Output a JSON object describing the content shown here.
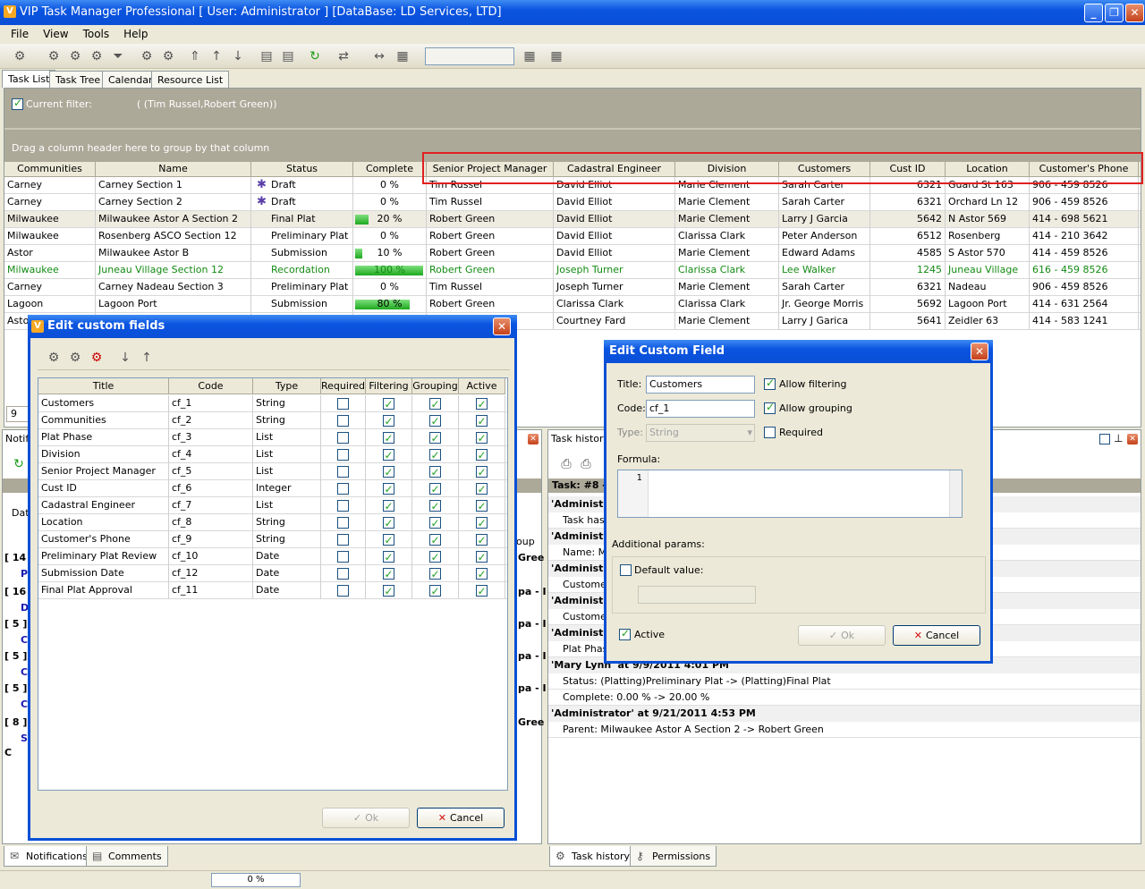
{
  "window": {
    "title": "VIP Task Manager Professional [ User: Administrator ] [DataBase: LD Services, LTD]"
  },
  "menu": [
    "File",
    "View",
    "Tools",
    "Help"
  ],
  "tabs": [
    "Task List",
    "Task Tree",
    "Calendar",
    "Resource List"
  ],
  "filter": {
    "label": "Current filter:",
    "value": "( (Tim Russel,Robert Green))"
  },
  "groupbar": {
    "hint": "Drag a column header here to group by that column"
  },
  "grid": {
    "columns": [
      "Communities",
      "Name",
      "Status",
      "Complete",
      "Senior Project Manager",
      "Cadastral Engineer",
      "Division",
      "Customers",
      "Cust ID",
      "Location",
      "Customer's Phone"
    ],
    "rows": [
      [
        "Carney",
        "Carney Section 1",
        "Draft",
        "0 %",
        "Tim Russel",
        "David Elliot",
        "Marie Clement",
        "Sarah Carter",
        "6321",
        "Guard St 163",
        "906 - 459 8526"
      ],
      [
        "Carney",
        "Carney Section 2",
        "Draft",
        "0 %",
        "Tim Russel",
        "David Elliot",
        "Marie Clement",
        "Sarah Carter",
        "6321",
        "Orchard Ln 12",
        "906 - 459 8526"
      ],
      [
        "Milwaukee",
        "Milwaukee  Astor A Section 2",
        "Final Plat",
        "20 %",
        "Robert Green",
        "David Elliot",
        "Marie Clement",
        "Larry J Garcia",
        "5642",
        "N Astor 569",
        "414 - 698 5621"
      ],
      [
        "Milwaukee",
        "Rosenberg ASCO Section 12",
        "Preliminary Plat",
        "0 %",
        "Robert Green",
        "David Elliot",
        "Clarissa Clark",
        "Peter Anderson",
        "6512",
        "Rosenberg",
        "414 - 210 3642"
      ],
      [
        "Astor",
        "Milwaukee Astor B",
        "Submission",
        "10 %",
        "Robert Green",
        "David Elliot",
        "Marie Clement",
        "Edward Adams",
        "4585",
        "S Astor 570",
        "414 - 459 8526"
      ],
      [
        "Milwaukee",
        "Juneau Village Section 12",
        "Recordation",
        "100 %",
        "Robert Green",
        "Joseph Turner",
        "Clarissa Clark",
        "Lee Walker",
        "1245",
        "Juneau Village",
        "616 - 459 8526"
      ],
      [
        "Carney",
        "Carney Nadeau Section 3",
        "Preliminary Plat",
        "0 %",
        "Tim Russel",
        "Joseph Turner",
        "Marie Clement",
        "Sarah Carter",
        "6321",
        "Nadeau",
        "906 - 459 8526"
      ],
      [
        "Lagoon",
        "Lagoon Port",
        "Submission",
        "80 %",
        "Robert Green",
        "Clarissa Clark",
        "Clarissa Clark",
        "Jr. George Morris",
        "5692",
        "Lagoon Port",
        "414 - 631 2564"
      ],
      [
        "Astor",
        "",
        "",
        "",
        "",
        "Courtney Fard",
        "Marie Clement",
        "Larry J Garica",
        "5641",
        "Zeidler 63",
        "414 - 583 1241"
      ]
    ],
    "progress": [
      0,
      0,
      20,
      0,
      10,
      100,
      0,
      80,
      0
    ],
    "footer_count": "9"
  },
  "panels": {
    "left_title": "Notifi",
    "left_label": "Dat",
    "left_group_col": "oup",
    "left_lines": [
      "[ 14",
      "P",
      "[ 16",
      "D",
      "[ 5 ]",
      "C",
      "[ 5 ]",
      "C",
      "[ 5 ]",
      "C",
      "[ 8 ]",
      "S",
      "C"
    ],
    "left_right": [
      "Gree",
      "",
      "pa - I",
      "",
      "pa - I",
      "",
      "pa - I",
      "",
      "pa - I",
      "",
      "Gree"
    ],
    "right_title": "Task history",
    "task_header": "Task: #8 -",
    "history": [
      {
        "type": "hdr",
        "text": "'Administr"
      },
      {
        "type": "sub",
        "text": "Task has"
      },
      {
        "type": "hdr",
        "text": "'Administr"
      },
      {
        "type": "sub",
        "text": "Name: M"
      },
      {
        "type": "hdr",
        "text": "'Administr"
      },
      {
        "type": "sub",
        "text": "Custome"
      },
      {
        "type": "hdr",
        "text": "'Administr"
      },
      {
        "type": "sub",
        "text": "Custome"
      },
      {
        "type": "hdr",
        "text": "'Administr"
      },
      {
        "type": "sub",
        "text": "Plat Phas"
      },
      {
        "type": "hdr",
        "text": "'Mary Lynn' at 9/9/2011 4:01 PM"
      },
      {
        "type": "sub",
        "text": "Status: (Platting)Preliminary Plat -> (Platting)Final Plat"
      },
      {
        "type": "sub",
        "text": "Complete: 0.00 % -> 20.00 %"
      },
      {
        "type": "hdr",
        "text": "'Administrator' at 9/21/2011 4:53 PM"
      },
      {
        "type": "sub",
        "text": "Parent: Milwaukee  Astor A Section 2 -> Robert Green"
      }
    ]
  },
  "bottom_tabs": {
    "left": [
      "Notifications",
      "Comments"
    ],
    "right": [
      "Task history",
      "Permissions"
    ]
  },
  "status": {
    "progress": "0 %"
  },
  "edit_fields_dialog": {
    "title": "Edit custom fields",
    "columns": [
      "Title",
      "Code",
      "Type",
      "Required",
      "Filtering",
      "Grouping",
      "Active"
    ],
    "rows": [
      {
        "title": "Customers",
        "code": "cf_1",
        "type": "String",
        "required": false,
        "filtering": true,
        "grouping": true,
        "active": true
      },
      {
        "title": "Communities",
        "code": "cf_2",
        "type": "String",
        "required": false,
        "filtering": true,
        "grouping": true,
        "active": true
      },
      {
        "title": "Plat Phase",
        "code": "cf_3",
        "type": "List",
        "required": false,
        "filtering": true,
        "grouping": true,
        "active": true
      },
      {
        "title": "Division",
        "code": "cf_4",
        "type": "List",
        "required": false,
        "filtering": true,
        "grouping": true,
        "active": true
      },
      {
        "title": "Senior Project Manager",
        "code": "cf_5",
        "type": "List",
        "required": false,
        "filtering": true,
        "grouping": true,
        "active": true
      },
      {
        "title": "Cust ID",
        "code": "cf_6",
        "type": "Integer",
        "required": false,
        "filtering": true,
        "grouping": true,
        "active": true
      },
      {
        "title": "Cadastral Engineer",
        "code": "cf_7",
        "type": "List",
        "required": false,
        "filtering": true,
        "grouping": true,
        "active": true
      },
      {
        "title": "Location",
        "code": "cf_8",
        "type": "String",
        "required": false,
        "filtering": true,
        "grouping": true,
        "active": true
      },
      {
        "title": "Customer's Phone",
        "code": "cf_9",
        "type": "String",
        "required": false,
        "filtering": true,
        "grouping": true,
        "active": true
      },
      {
        "title": "Preliminary Plat Review",
        "code": "cf_10",
        "type": "Date",
        "required": false,
        "filtering": true,
        "grouping": true,
        "active": true
      },
      {
        "title": "Submission Date",
        "code": "cf_12",
        "type": "Date",
        "required": false,
        "filtering": true,
        "grouping": true,
        "active": true
      },
      {
        "title": "Final Plat Approval",
        "code": "cf_11",
        "type": "Date",
        "required": false,
        "filtering": true,
        "grouping": true,
        "active": true
      }
    ],
    "ok": "Ok",
    "cancel": "Cancel"
  },
  "edit_field_dialog": {
    "title": "Edit Custom Field",
    "title_label": "Title:",
    "title_value": "Customers",
    "code_label": "Code:",
    "code_value": "cf_1",
    "type_label": "Type:",
    "type_value": "String",
    "allow_filtering": "Allow filtering",
    "allow_grouping": "Allow grouping",
    "required": "Required",
    "formula_label": "Formula:",
    "formula_line": "1",
    "additional_params": "Additional params:",
    "default_value": "Default value:",
    "active": "Active",
    "ok": "Ok",
    "cancel": "Cancel"
  }
}
